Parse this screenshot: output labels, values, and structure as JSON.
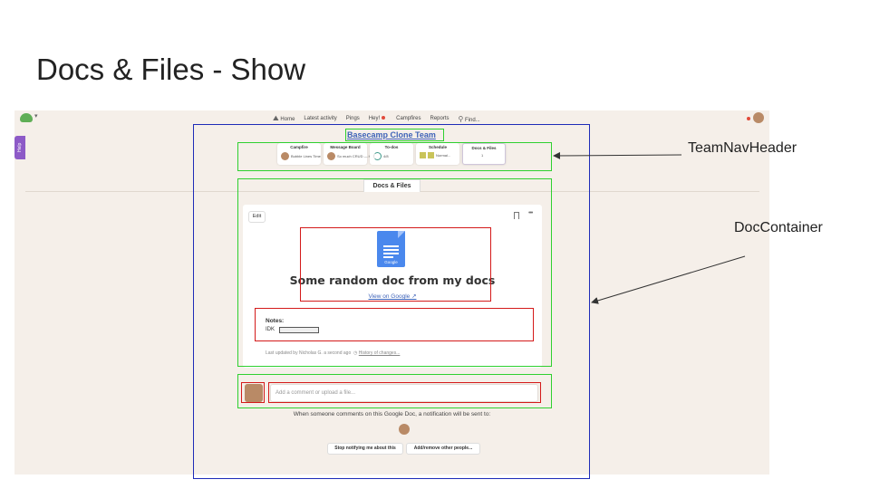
{
  "slide": {
    "title": "Docs & Files - Show"
  },
  "topbar": {
    "logo_caret": "▾",
    "nav_items": [
      "Home",
      "Latest activity",
      "Pings",
      "Hey!",
      "Campfires",
      "Reports",
      "Find..."
    ]
  },
  "help": {
    "label": "Help"
  },
  "team": {
    "name": "Basecamp Clone Team"
  },
  "tools": [
    {
      "title": "Campfire",
      "body": "Bubble Lines Time"
    },
    {
      "title": "Message Board",
      "body": "So much CRUD — hell"
    },
    {
      "title": "To-dos",
      "body": "4/8"
    },
    {
      "title": "Schedule",
      "body": "Normal..."
    },
    {
      "title": "Docs & Files",
      "body": "1"
    }
  ],
  "doc_tab": {
    "label": "Docs & Files"
  },
  "doc": {
    "edit_label": "Edit",
    "google_label": "Google",
    "title": "Some random doc from my docs",
    "view_link": "View on Google ↗",
    "notes_label": "Notes:",
    "notes_text": "IDK",
    "updated": "Last updated by Nicholas G. a second ago",
    "history_link": "History of changes..."
  },
  "comment": {
    "placeholder": "Add a comment or upload a file..."
  },
  "notify": {
    "text": "When someone comments on this Google Doc, a notification will be sent to:",
    "stop_label": "Stop notifying me about this",
    "add_label": "Add/remove other people..."
  },
  "annotations": {
    "team_nav_header": "TeamNavHeader",
    "doc_container": "DocContainer"
  },
  "colors": {
    "app_bg": "#f5efe9",
    "link": "#3f63b8",
    "outline_blue": "#1e2bb8",
    "outline_green": "#2fd02f",
    "outline_red": "#d41a1a",
    "doc_icon": "#4a88ed"
  }
}
